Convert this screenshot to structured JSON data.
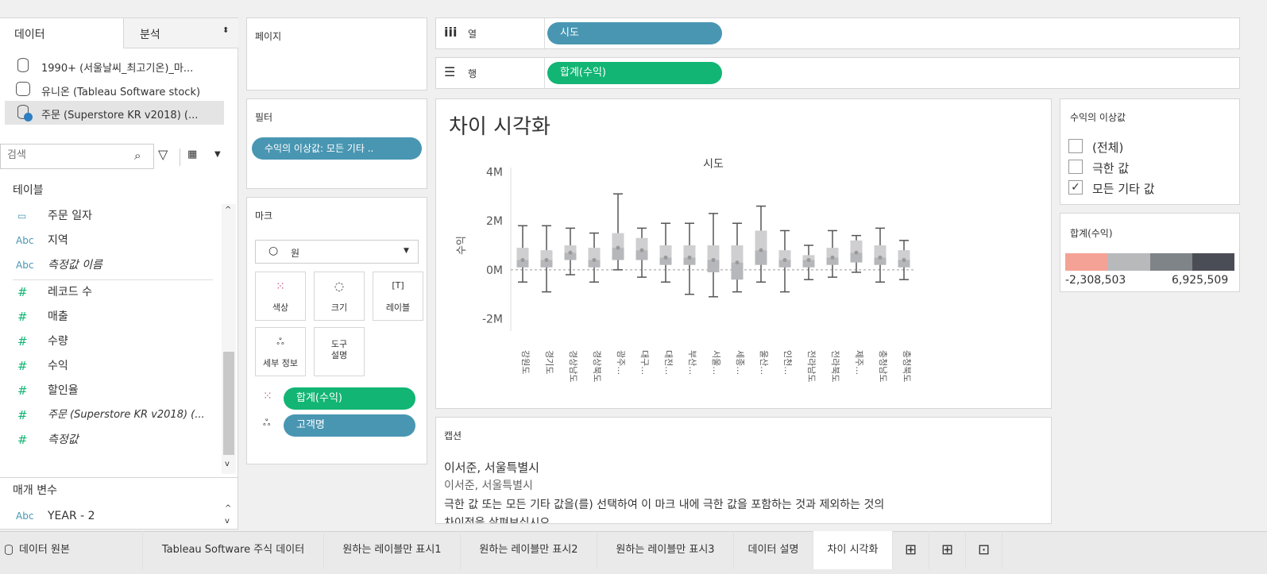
{
  "side": {
    "tab_data": "데이터",
    "tab_analysis": "분석",
    "sources": [
      "1990+ (서울날씨_최고기온)_마...",
      "유니온 (Tableau Software stock)",
      "주문 (Superstore KR v2018) (..."
    ],
    "search_placeholder": "검색",
    "tables_heading": "테이블",
    "fields": [
      {
        "icon": "calendar",
        "label": "주문 일자",
        "italic": false
      },
      {
        "icon": "Abc",
        "label": "지역",
        "italic": false
      },
      {
        "icon": "Abc",
        "label": "측정값 이름",
        "italic": true
      },
      {
        "icon": "#",
        "label": "레코드 수",
        "italic": false
      },
      {
        "icon": "#",
        "label": "매출",
        "italic": false
      },
      {
        "icon": "#",
        "label": "수량",
        "italic": false
      },
      {
        "icon": "#",
        "label": "수익",
        "italic": false
      },
      {
        "icon": "#",
        "label": "할인율",
        "italic": false
      },
      {
        "icon": "#",
        "label": "주문 (Superstore KR v2018) (...",
        "italic": true
      },
      {
        "icon": "#",
        "label": "측정값",
        "italic": true
      }
    ],
    "params_heading": "매개 변수",
    "param": {
      "icon": "Abc",
      "label": "YEAR - 2"
    }
  },
  "shelves": {
    "pages": "페이지",
    "filters": "필터",
    "filter_pill": "수익의 이상값: 모든 기타 ..",
    "marks": "마크",
    "mark_type": "원",
    "mark_type_icon": "○",
    "btn_color": "색상",
    "btn_size": "크기",
    "btn_label": "레이블",
    "btn_detail": "세부 정보",
    "btn_tooltip": "도구\n설명",
    "mark_pill_1": "합계(수익)",
    "mark_pill_2": "고객명",
    "columns_label": "열",
    "columns_icon": "iii",
    "columns_pill": "시도",
    "rows_label": "행",
    "rows_icon": "☰",
    "rows_pill": "합계(수익)"
  },
  "sheet_title": "차이 시각화",
  "chart_data": {
    "type": "box",
    "title": "시도",
    "ylabel": "수익",
    "ylim": [
      -2.5,
      4.5
    ],
    "y_ticks": [
      "4M",
      "2M",
      "0M",
      "-2M"
    ],
    "y_tick_values": [
      4,
      2,
      0,
      -2
    ],
    "categories": [
      "강원도",
      "경기도",
      "경상남도",
      "경상북도",
      "광주광역시",
      "대구광역시",
      "대전광역시",
      "부산광역시",
      "서울특별시",
      "세종특별자치시",
      "울산광역시",
      "인천광역시",
      "전라남도",
      "전라북도",
      "제주특별자치도",
      "충청남도",
      "충청북도"
    ],
    "category_labels": [
      "강원도",
      "경기도",
      "경상남도",
      "경상북도",
      "광주…",
      "대구…",
      "대전…",
      "부산…",
      "서울…",
      "세종…",
      "울산…",
      "인천…",
      "전라남도",
      "전라북도",
      "제주…",
      "충청남도",
      "충청북도"
    ],
    "boxes": [
      {
        "low": -0.5,
        "q1": 0.1,
        "median": 0.4,
        "q3": 0.9,
        "high": 1.8
      },
      {
        "low": -0.9,
        "q1": 0.1,
        "median": 0.4,
        "q3": 0.8,
        "high": 1.8
      },
      {
        "low": -0.2,
        "q1": 0.4,
        "median": 0.7,
        "q3": 1.0,
        "high": 1.7
      },
      {
        "low": -0.5,
        "q1": 0.1,
        "median": 0.4,
        "q3": 0.9,
        "high": 1.5
      },
      {
        "low": 0.0,
        "q1": 0.4,
        "median": 0.9,
        "q3": 1.5,
        "high": 3.1
      },
      {
        "low": -0.3,
        "q1": 0.4,
        "median": 0.8,
        "q3": 1.3,
        "high": 1.7
      },
      {
        "low": -0.5,
        "q1": 0.2,
        "median": 0.5,
        "q3": 1.0,
        "high": 1.9
      },
      {
        "low": -1.0,
        "q1": 0.2,
        "median": 0.5,
        "q3": 1.0,
        "high": 1.9
      },
      {
        "low": -1.1,
        "q1": -0.1,
        "median": 0.4,
        "q3": 1.0,
        "high": 2.3
      },
      {
        "low": -0.9,
        "q1": -0.4,
        "median": 0.3,
        "q3": 1.0,
        "high": 1.9
      },
      {
        "low": -0.5,
        "q1": 0.2,
        "median": 0.8,
        "q3": 1.6,
        "high": 2.6
      },
      {
        "low": -0.9,
        "q1": 0.1,
        "median": 0.4,
        "q3": 0.8,
        "high": 1.6
      },
      {
        "low": -0.4,
        "q1": 0.1,
        "median": 0.4,
        "q3": 0.6,
        "high": 1.0
      },
      {
        "low": -0.3,
        "q1": 0.2,
        "median": 0.5,
        "q3": 0.9,
        "high": 1.6
      },
      {
        "low": -0.1,
        "q1": 0.3,
        "median": 0.7,
        "q3": 1.2,
        "high": 1.4
      },
      {
        "low": -0.5,
        "q1": 0.2,
        "median": 0.5,
        "q3": 1.0,
        "high": 1.7
      },
      {
        "low": -0.4,
        "q1": 0.1,
        "median": 0.4,
        "q3": 0.8,
        "high": 1.2
      }
    ],
    "grid": false,
    "zero_line": true
  },
  "legend_filter": {
    "title": "수익의 이상값",
    "options": [
      {
        "label": "(전체)",
        "checked": false
      },
      {
        "label": "극한 값",
        "checked": false
      },
      {
        "label": "모든 기타 값",
        "checked": true
      }
    ]
  },
  "legend_color": {
    "title": "합계(수익)",
    "min": "-2,308,503",
    "max": "6,925,509",
    "colors": [
      "#f5a296",
      "#b7b9bb",
      "#7f8489",
      "#4a4d55"
    ]
  },
  "caption": {
    "heading": "캡션",
    "line1": "이서준, 서울특별시",
    "line2": "이서준, 서울특별시",
    "line3": "극한 값 또는 모든 기타 값을(를) 선택하여 이 마크 내에 극한 값을 포함하는 것과 제외하는 것의",
    "line4": "차이점을 살펴보십시오."
  },
  "tabs": {
    "datasource": "데이터 원본",
    "sheets": [
      "Tableau Software 주식 데이터",
      "원하는 레이블만 표시1",
      "원하는 레이블만 표시2",
      "원하는 레이블만 표시3",
      "데이터 설명",
      "차이 시각화"
    ]
  }
}
